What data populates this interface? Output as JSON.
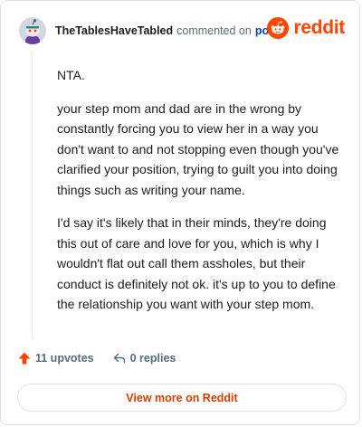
{
  "comment": {
    "username": "TheTablesHaveTabled",
    "action_text": "commented on",
    "post_link_text": "post",
    "paragraphs": [
      "NTA.",
      "your step mom and dad are in the wrong by constantly forcing you to view her in a way you don't want to and not stopping even though you've clarified your position, trying to guilt you into doing things such as writing your name.",
      "I'd say it's likely that in their minds, they're doing this out of care and love for you, which is why I wouldn't flat out call them assholes, but their conduct is definitely not ok. it's up to you to define the relationship you want with your step mom."
    ]
  },
  "brand": {
    "wordmark": "reddit",
    "icon": "reddit-snoo-icon",
    "color": "#ff4500"
  },
  "avatar": {
    "icon": "snoo-avatar-icon"
  },
  "actions": {
    "upvotes_label": "11 upvotes",
    "upvote_icon": "upvote-arrow-icon",
    "upvote_color": "#ff4500",
    "replies_label": "0 replies",
    "reply_icon": "reply-arrow-icon"
  },
  "footer": {
    "view_more_label": "View more on Reddit",
    "accent": "#d93a00"
  }
}
